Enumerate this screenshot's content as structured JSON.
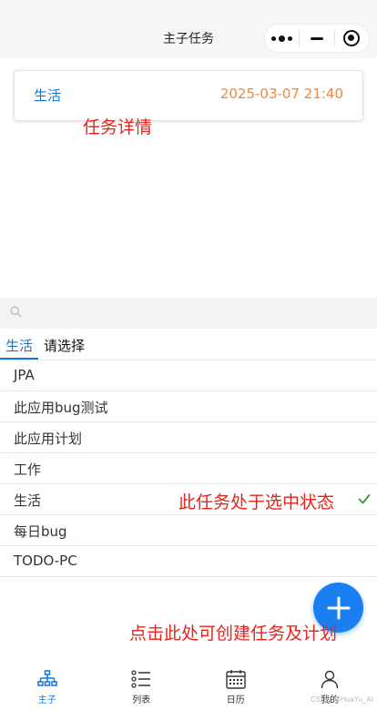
{
  "header": {
    "title": "主子任务"
  },
  "detail_card": {
    "category": "生活",
    "datetime": "2025-03-07 21:40"
  },
  "annotations": {
    "task_detail": "任务详情",
    "selected_state": "此任务处于选中状态",
    "create_hint": "点击此处可创建任务及计划"
  },
  "search": {
    "placeholder": "",
    "value": ""
  },
  "tabs": {
    "active": "生活",
    "select_prompt": "请选择"
  },
  "task_list": [
    {
      "label": "JPA",
      "selected": false
    },
    {
      "label": "此应用bug测试",
      "selected": false
    },
    {
      "label": "此应用计划",
      "selected": false
    },
    {
      "label": "工作",
      "selected": false
    },
    {
      "label": "生活",
      "selected": true
    },
    {
      "label": "每日bug",
      "selected": false
    },
    {
      "label": "TODO-PC",
      "selected": false
    }
  ],
  "fab": {
    "icon": "plus-icon"
  },
  "tabbar": [
    {
      "label": "主子",
      "icon": "hierarchy-icon",
      "active": true
    },
    {
      "label": "列表",
      "icon": "list-icon",
      "active": false
    },
    {
      "label": "日历",
      "icon": "calendar-icon",
      "active": false
    },
    {
      "label": "我的",
      "icon": "user-icon",
      "active": false
    }
  ],
  "watermark": "CSDN @HuaYu_AI",
  "colors": {
    "primary": "#1677d2",
    "fab": "#1a7ff0",
    "datetime": "#f0883a",
    "annotation": "#e8221c",
    "check": "#2e9e3e"
  }
}
